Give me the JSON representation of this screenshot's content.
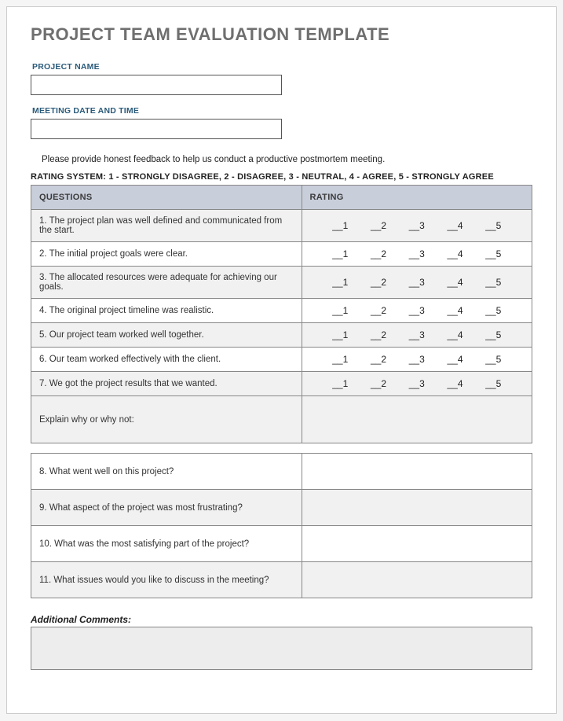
{
  "title": "PROJECT TEAM EVALUATION TEMPLATE",
  "fields": {
    "project_name_label": "PROJECT NAME",
    "project_name_value": "",
    "meeting_label": "MEETING DATE AND TIME",
    "meeting_value": ""
  },
  "instruction": "Please provide honest feedback to help us conduct a productive postmortem meeting.",
  "rating_legend": "RATING SYSTEM: 1 - STRONGLY DISAGREE, 2 - DISAGREE, 3 - NEUTRAL, 4 - AGREE, 5 - STRONGLY AGREE",
  "headers": {
    "questions": "QUESTIONS",
    "rating": "RATING"
  },
  "rating_options": [
    "__1",
    "__2",
    "__3",
    "__4",
    "__5"
  ],
  "questions_rated": [
    "1. The project plan was well defined and communicated from the start.",
    "2. The initial project goals were clear.",
    "3. The allocated resources were adequate for achieving our goals.",
    "4. The original project timeline was realistic.",
    "5. Our project team worked well together.",
    "6. Our team worked effectively with the client.",
    "7. We got the project results that we wanted."
  ],
  "explain_label": "Explain why or why not:",
  "questions_open": [
    "8. What went well on this project?",
    "9. What aspect of the project was most frustrating?",
    "10. What was the most satisfying part of the project?",
    "11. What issues would you like to discuss in the meeting?"
  ],
  "additional_label": "Additional Comments:",
  "additional_value": ""
}
